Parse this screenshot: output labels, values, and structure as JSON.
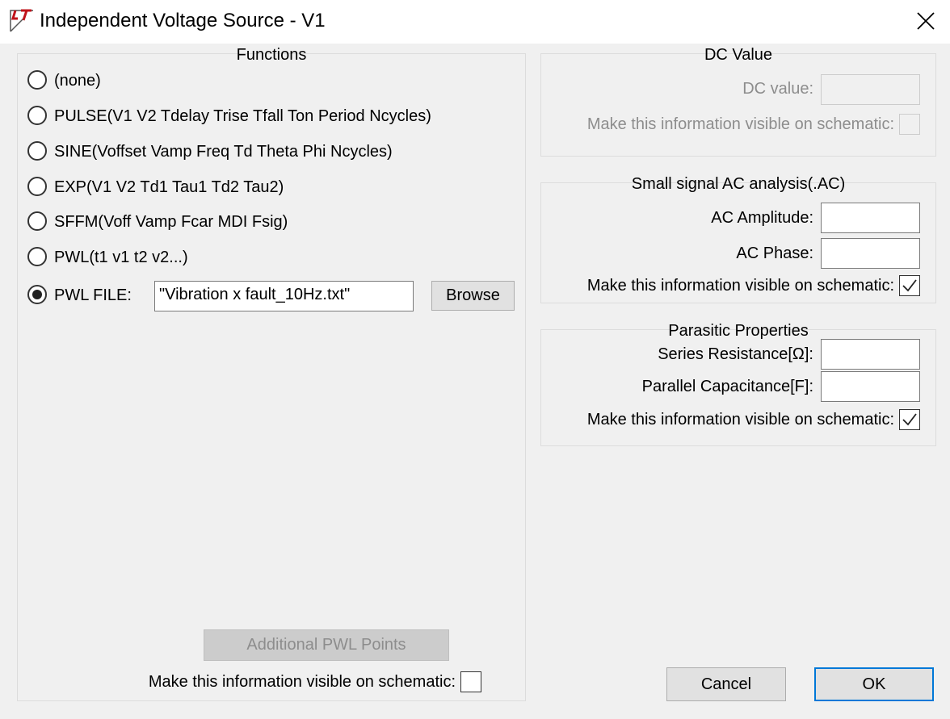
{
  "window": {
    "title": "Independent Voltage Source - V1",
    "icon": "ltspice-logo-icon",
    "close_icon": "close-icon"
  },
  "functions": {
    "title": "Functions",
    "options": [
      {
        "label": "(none)",
        "selected": false
      },
      {
        "label": "PULSE(V1 V2 Tdelay Trise Tfall Ton Period Ncycles)",
        "selected": false
      },
      {
        "label": "SINE(Voffset Vamp Freq Td Theta Phi Ncycles)",
        "selected": false
      },
      {
        "label": "EXP(V1 V2 Td1 Tau1 Td2 Tau2)",
        "selected": false
      },
      {
        "label": "SFFM(Voff Vamp Fcar MDI Fsig)",
        "selected": false
      },
      {
        "label": "PWL(t1 v1 t2 v2...)",
        "selected": false
      },
      {
        "label": "PWL FILE:",
        "selected": true
      }
    ],
    "pwl_file_value": "\"Vibration x fault_10Hz.txt\"",
    "browse_label": "Browse",
    "additional_pwl_label": "Additional PWL Points",
    "visible_label": "Make this information visible on schematic:",
    "visible_checked": false
  },
  "dc_value": {
    "title": "DC Value",
    "field_label": "DC value:",
    "field_value": "",
    "visible_label": "Make this information visible on schematic:",
    "visible_checked": false,
    "enabled": false
  },
  "ac_analysis": {
    "title": "Small signal AC analysis(.AC)",
    "amplitude_label": "AC Amplitude:",
    "amplitude_value": "",
    "phase_label": "AC Phase:",
    "phase_value": "",
    "visible_label": "Make this information visible on schematic:",
    "visible_checked": true
  },
  "parasitic": {
    "title": "Parasitic Properties",
    "series_label": "Series Resistance[Ω]:",
    "series_value": "",
    "parallel_label": "Parallel Capacitance[F]:",
    "parallel_value": "",
    "visible_label": "Make this information visible on schematic:",
    "visible_checked": true
  },
  "buttons": {
    "cancel_label": "Cancel",
    "ok_label": "OK"
  },
  "colors": {
    "accent": "#0078d7",
    "background": "#f0f0f0",
    "disabled_text": "#8d8d8d"
  }
}
